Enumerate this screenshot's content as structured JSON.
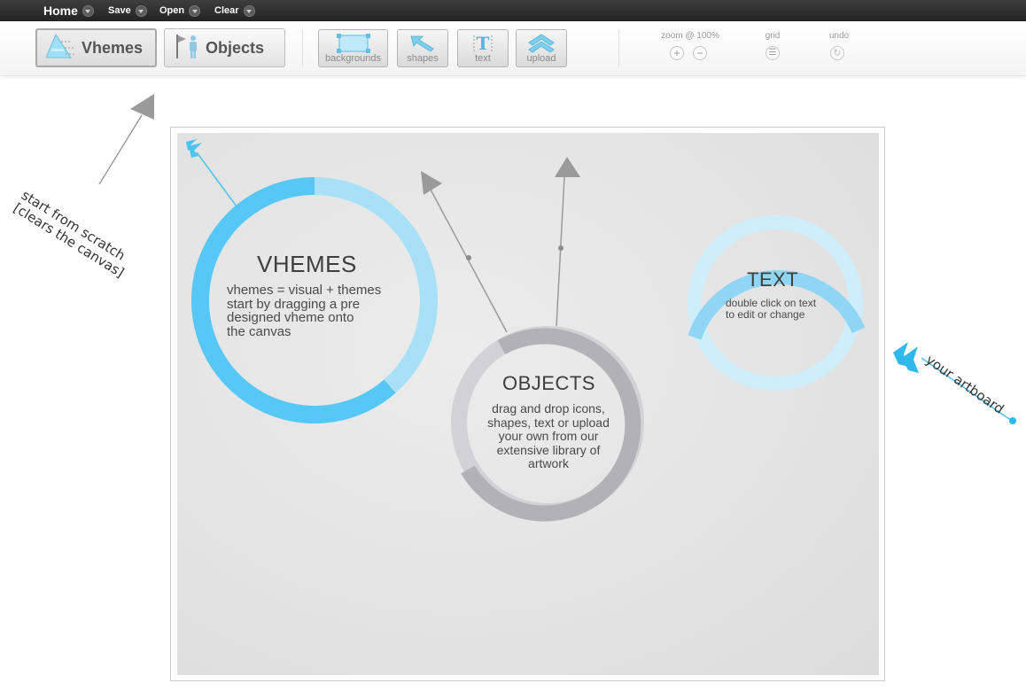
{
  "menubar": {
    "home": "Home",
    "save": "Save",
    "open": "Open",
    "clear": "Clear"
  },
  "toolbar": {
    "vhemes_label": "Vhemes",
    "objects_label": "Objects",
    "tools": {
      "backgrounds": "backgrounds",
      "shapes": "shapes",
      "text": "text",
      "upload": "upload"
    },
    "zoom_label": "zoom @ 100%",
    "grid_label": "grid",
    "undo_label": "undo"
  },
  "artboard": {
    "vhemes": {
      "title": "VHEMES",
      "lines": [
        "vhemes = visual + themes",
        "start by dragging a pre",
        "designed vheme onto",
        "the canvas"
      ]
    },
    "objects": {
      "title": "OBJECTS",
      "lines": [
        "drag and drop icons,",
        "shapes, text or upload",
        "your own from our",
        "extensive library of",
        "artwork"
      ]
    },
    "text": {
      "title": "TEXT",
      "lines": [
        "double click on text",
        "to edit or change"
      ]
    }
  },
  "annotations": {
    "start_from_scratch": [
      "start from scratch",
      "[clears the canvas]"
    ],
    "your_artboard": "your artboard"
  },
  "colors": {
    "accent_blue": "#57c8f5",
    "light_blue": "#a8e0f8",
    "gray_ring": "#b2b2b6",
    "light_gray_ring": "#d2d2d4",
    "menubar": "#2e2e2e"
  }
}
